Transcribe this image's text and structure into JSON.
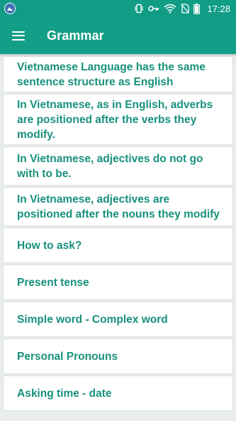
{
  "status_bar": {
    "time": "17:28",
    "icons": [
      "app-notification-icon",
      "vibrate-icon",
      "key-icon",
      "wifi-icon",
      "no-sim-icon",
      "battery-icon"
    ],
    "color": "#119d85"
  },
  "app_bar": {
    "title": "Grammar",
    "menu_icon": "hamburger-menu-icon",
    "color": "#139e87"
  },
  "accent_text_color": "#18917c",
  "grammar_topics": [
    "Vietnamese Language has the same sentence structure as English",
    "In Vietnamese, as in English, adverbs are positioned after the verbs they modify.",
    "In Vietnamese, adjectives do not go with to be.",
    "In Vietnamese, adjectives are positioned after the nouns they modify",
    "How to ask?",
    "Present tense",
    "Simple word - Complex word",
    "Personal Pronouns",
    "Asking time - date"
  ]
}
